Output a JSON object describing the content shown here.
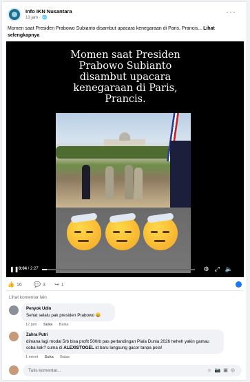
{
  "post": {
    "page_name": "Info IKN Nusantara",
    "time": "13 jam",
    "privacy_icon": "globe-icon",
    "caption": "Momen saat Presiden Prabowo Subianto disambut upacara kenegaraan di Paris, Prancis...",
    "see_more": "Lihat selengkapnya"
  },
  "video": {
    "overlay_title": "Momen saat Presiden Prabowo Subianto disambut upacara kenegaraan di Paris, Prancis.",
    "current_time": "0:04",
    "duration": "2:27",
    "progress_fraction": 0.03,
    "emoji": "😶‍🌫️"
  },
  "stats": {
    "likes": "16",
    "comments": "3",
    "shares": "1"
  },
  "comments_header": "Lihat komentar lain",
  "comments": [
    {
      "author": "Penyok Udin",
      "text": "Sehat selalu pak presiden Prabowo 😄",
      "time": "12 jam",
      "like": "Suka",
      "reply": "Balas",
      "avatar_color": "#8a8f9a"
    },
    {
      "author": "Zahra Putri",
      "text_pre": "dimana lagi modal 5rb bisa profit 500rb pas pertandingan Piala Dunia 2026 heheh yakin gamau coba kak? cuma di ",
      "text_bold": "ALEXISTOGEL",
      "text_post": " id baru langsung gacor tanpa pola!",
      "time": "1 menit",
      "like": "Suka",
      "reply": "Balas",
      "avatar_color": "#c79a7a"
    }
  ],
  "compose": {
    "placeholder": "Tulis komentar..."
  }
}
